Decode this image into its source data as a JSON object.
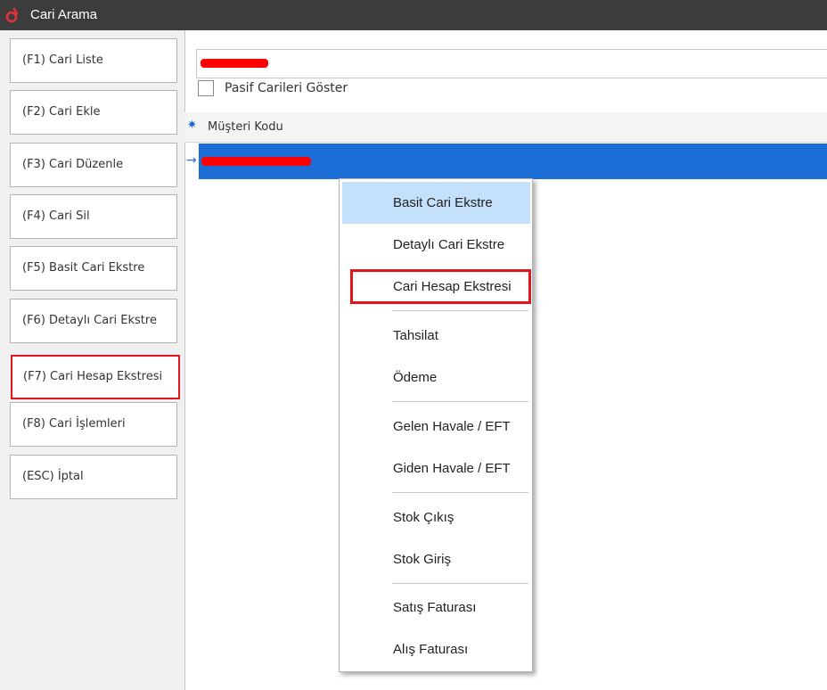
{
  "window": {
    "title": "Cari Arama"
  },
  "sidebar": {
    "items": [
      {
        "label": "(F1) Cari Liste"
      },
      {
        "label": "(F2) Cari Ekle"
      },
      {
        "label": "(F3) Cari Düzenle"
      },
      {
        "label": "(F4) Cari Sil"
      },
      {
        "label": "(F5) Basit Cari Ekstre"
      },
      {
        "label": "(F6) Detaylı Cari Ekstre"
      },
      {
        "label": "(F7) Cari Hesap Ekstresi"
      },
      {
        "label": "(F8) Cari İşlemleri"
      },
      {
        "label": "(ESC) İptal"
      }
    ]
  },
  "filters": {
    "show_passive_label": "Pasif Carileri Göster",
    "show_passive_checked": false
  },
  "grid": {
    "columns": [
      {
        "label": "Müşteri Kodu"
      }
    ]
  },
  "context_menu": {
    "items": [
      {
        "label": "Basit Cari Ekstre"
      },
      {
        "label": "Detaylı Cari Ekstre"
      },
      {
        "label": "Cari Hesap Ekstresi"
      },
      {
        "label": "Tahsilat"
      },
      {
        "label": "Ödeme"
      },
      {
        "label": "Gelen Havale / EFT"
      },
      {
        "label": "Giden Havale / EFT"
      },
      {
        "label": "Stok Çıkış"
      },
      {
        "label": "Stok Giriş"
      },
      {
        "label": "Satış Faturası"
      },
      {
        "label": "Alış Faturası"
      }
    ]
  },
  "colors": {
    "selection": "#1c6ed6",
    "highlight_border": "#e3141c",
    "menu_hover": "#c5e0fb"
  }
}
